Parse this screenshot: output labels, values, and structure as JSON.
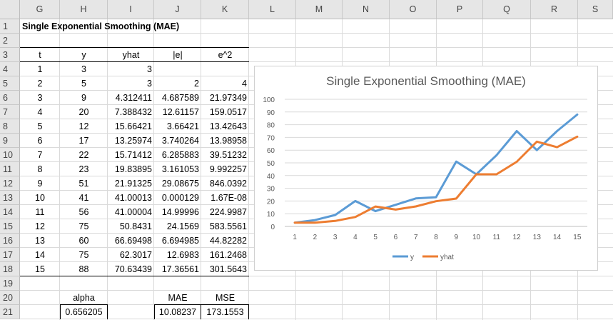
{
  "columns": [
    "G",
    "H",
    "I",
    "J",
    "K",
    "L",
    "M",
    "N",
    "O",
    "P",
    "Q",
    "R",
    "S"
  ],
  "rows": [
    "1",
    "2",
    "3",
    "4",
    "5",
    "6",
    "7",
    "8",
    "9",
    "10",
    "11",
    "12",
    "13",
    "14",
    "15",
    "16",
    "17",
    "18",
    "19",
    "20",
    "21"
  ],
  "sheet": {
    "title": "Single Exponential Smoothing (MAE)",
    "headers": [
      "t",
      "y",
      "yhat",
      "|e|",
      "e^2"
    ],
    "table": [
      [
        "1",
        "3",
        "3",
        "",
        ""
      ],
      [
        "2",
        "5",
        "3",
        "2",
        "4"
      ],
      [
        "3",
        "9",
        "4.312411",
        "4.687589",
        "21.97349"
      ],
      [
        "4",
        "20",
        "7.388432",
        "12.61157",
        "159.0517"
      ],
      [
        "5",
        "12",
        "15.66421",
        "3.66421",
        "13.42643"
      ],
      [
        "6",
        "17",
        "13.25974",
        "3.740264",
        "13.98958"
      ],
      [
        "7",
        "22",
        "15.71412",
        "6.285883",
        "39.51232"
      ],
      [
        "8",
        "23",
        "19.83895",
        "3.161053",
        "9.992257"
      ],
      [
        "9",
        "51",
        "21.91325",
        "29.08675",
        "846.0392"
      ],
      [
        "10",
        "41",
        "41.00013",
        "0.000129",
        "1.67E-08"
      ],
      [
        "11",
        "56",
        "41.00004",
        "14.99996",
        "224.9987"
      ],
      [
        "12",
        "75",
        "50.8431",
        "24.1569",
        "583.5561"
      ],
      [
        "13",
        "60",
        "66.69498",
        "6.694985",
        "44.82282"
      ],
      [
        "14",
        "75",
        "62.3017",
        "12.6983",
        "161.2468"
      ],
      [
        "15",
        "88",
        "70.63439",
        "17.36561",
        "301.5643"
      ]
    ],
    "alpha_label": "alpha",
    "alpha_value": "0.656205",
    "mae_label": "MAE",
    "mse_label": "MSE",
    "mae_value": "10.08237",
    "mse_value": "173.1553"
  },
  "chart_data": {
    "type": "line",
    "title": "Single Exponential Smoothing (MAE)",
    "categories": [
      "1",
      "2",
      "3",
      "4",
      "5",
      "6",
      "7",
      "8",
      "9",
      "10",
      "11",
      "12",
      "13",
      "14",
      "15"
    ],
    "ylim": [
      0,
      100
    ],
    "yticks": [
      "0",
      "10",
      "20",
      "30",
      "40",
      "50",
      "60",
      "70",
      "80",
      "90",
      "100"
    ],
    "grid": true,
    "legend": "bottom",
    "series": [
      {
        "name": "y",
        "color": "#5b9bd5",
        "values": [
          3,
          5,
          9,
          20,
          12,
          17,
          22,
          23,
          51,
          41,
          56,
          75,
          60,
          75,
          88
        ]
      },
      {
        "name": "yhat",
        "color": "#ed7d31",
        "values": [
          3,
          3,
          4.312411,
          7.388432,
          15.66421,
          13.25974,
          15.71412,
          19.83895,
          21.91325,
          41.00013,
          41.00004,
          50.8431,
          66.69498,
          62.3017,
          70.63439
        ]
      }
    ]
  }
}
